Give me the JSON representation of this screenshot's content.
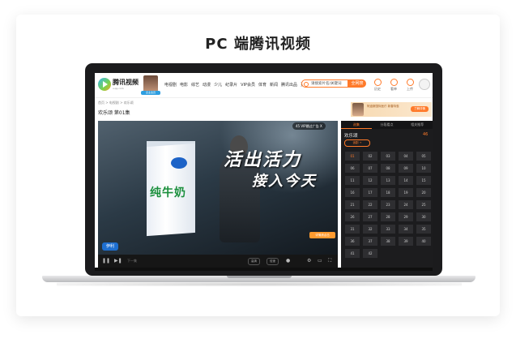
{
  "page": {
    "title": "PC 端腾讯视频"
  },
  "app": {
    "logo_text": "腾讯视频",
    "logo_sub": "v.qq.com",
    "avatar_tag": "企业会员"
  },
  "nav": {
    "links": [
      "电视剧",
      "电影",
      "综艺",
      "动漫",
      "少儿",
      "纪录片",
      "VIP会员",
      "体育",
      "新闻",
      "腾讯出品",
      "更多"
    ]
  },
  "search": {
    "placeholder": "请搜索片名/关键词",
    "button_label": "全网搜"
  },
  "toolbar": {
    "history": "历史",
    "records": "看单",
    "upload": "上传"
  },
  "breadcrumb": "首页 > 电视剧 > 欢乐颂",
  "video": {
    "title": "欢乐颂 第01集"
  },
  "ad_banner": {
    "text": "阿迪斯国际医疗 新春特惠",
    "button": "了解详情"
  },
  "player": {
    "slogan_line1": "活出活力",
    "slogan_line2": "接入今天",
    "milk_label": "纯牛奶",
    "brand": "伊利",
    "countdown": "45 VIP跳过广告 X",
    "detail_button": "详情请点击"
  },
  "controls": {
    "play": "❚❚",
    "next": "▶❚",
    "next_label": "下一集",
    "quality": "高清",
    "speed": "倍速"
  },
  "side_panel": {
    "tabs": [
      "选集",
      "分段看点",
      "相关推荐"
    ],
    "active_tab": 0,
    "title": "欢乐颂",
    "count": "46",
    "follow_button": "追剧 +"
  },
  "episodes": [
    "01",
    "02",
    "03",
    "04",
    "05",
    "06",
    "07",
    "08",
    "09",
    "10",
    "11",
    "12",
    "13",
    "14",
    "15",
    "16",
    "17",
    "18",
    "19",
    "20",
    "21",
    "22",
    "23",
    "24",
    "25",
    "26",
    "27",
    "28",
    "29",
    "30",
    "31",
    "32",
    "33",
    "34",
    "35",
    "36",
    "37",
    "38",
    "39",
    "40",
    "41",
    "42"
  ],
  "current_episode": 0,
  "colors": {
    "accent": "#ff7a2a",
    "panel_bg": "#1c1c1e",
    "player_bg": "#1f2a33"
  }
}
